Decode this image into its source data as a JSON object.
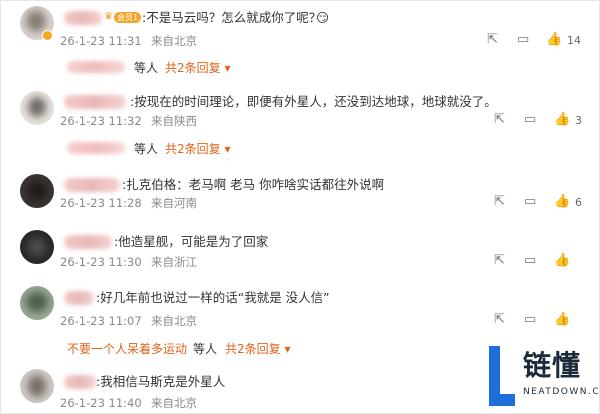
{
  "comments": [
    {
      "text": ":不是马云吗？怎么就成你了呢？",
      "emoji": "😏",
      "time": "26-1-23 11:31",
      "location": "来自北京",
      "likes": "14",
      "vip": "会员1"
    },
    {
      "text": ":按现在的时间理论，即便有外星人，还没到达地球，地球就没了。",
      "time": "26-1-23 11:32",
      "location": "来自陕西",
      "likes": "3"
    },
    {
      "text": ":扎克伯格：老马啊 老马 你咋啥实话都往外说啊",
      "time": "26-1-23 11:28",
      "location": "来自河南",
      "likes": "6"
    },
    {
      "text": ":他造星舰，可能是为了回家",
      "time": "26-1-23 11:30",
      "location": "来自浙江",
      "likes": ""
    },
    {
      "text": ":好几年前也说过一样的话“我就是 没人信”",
      "time": "26-1-23 11:07",
      "location": "来自北京",
      "likes": ""
    },
    {
      "text": ":我相信马斯克是外星人",
      "time": "26-1-23 11:40",
      "location": "来自北京",
      "likes": ""
    }
  ],
  "replies": [
    {
      "who": "",
      "suffix": "等人",
      "more": "共2条回复 ▾"
    },
    {
      "who": "",
      "suffix": "等人",
      "more": "共2条回复 ▾"
    },
    {
      "who": "不要一个人呆着多运动",
      "suffix": "等人",
      "more": "共2条回复 ▾"
    }
  ],
  "blurred_names": {
    "c3": "怀...肥肥",
    "c4": "无宗庆..."
  },
  "logo": {
    "cn": "链懂",
    "en": "NEATDOWN.COM",
    "color": "#1e6fd9"
  }
}
